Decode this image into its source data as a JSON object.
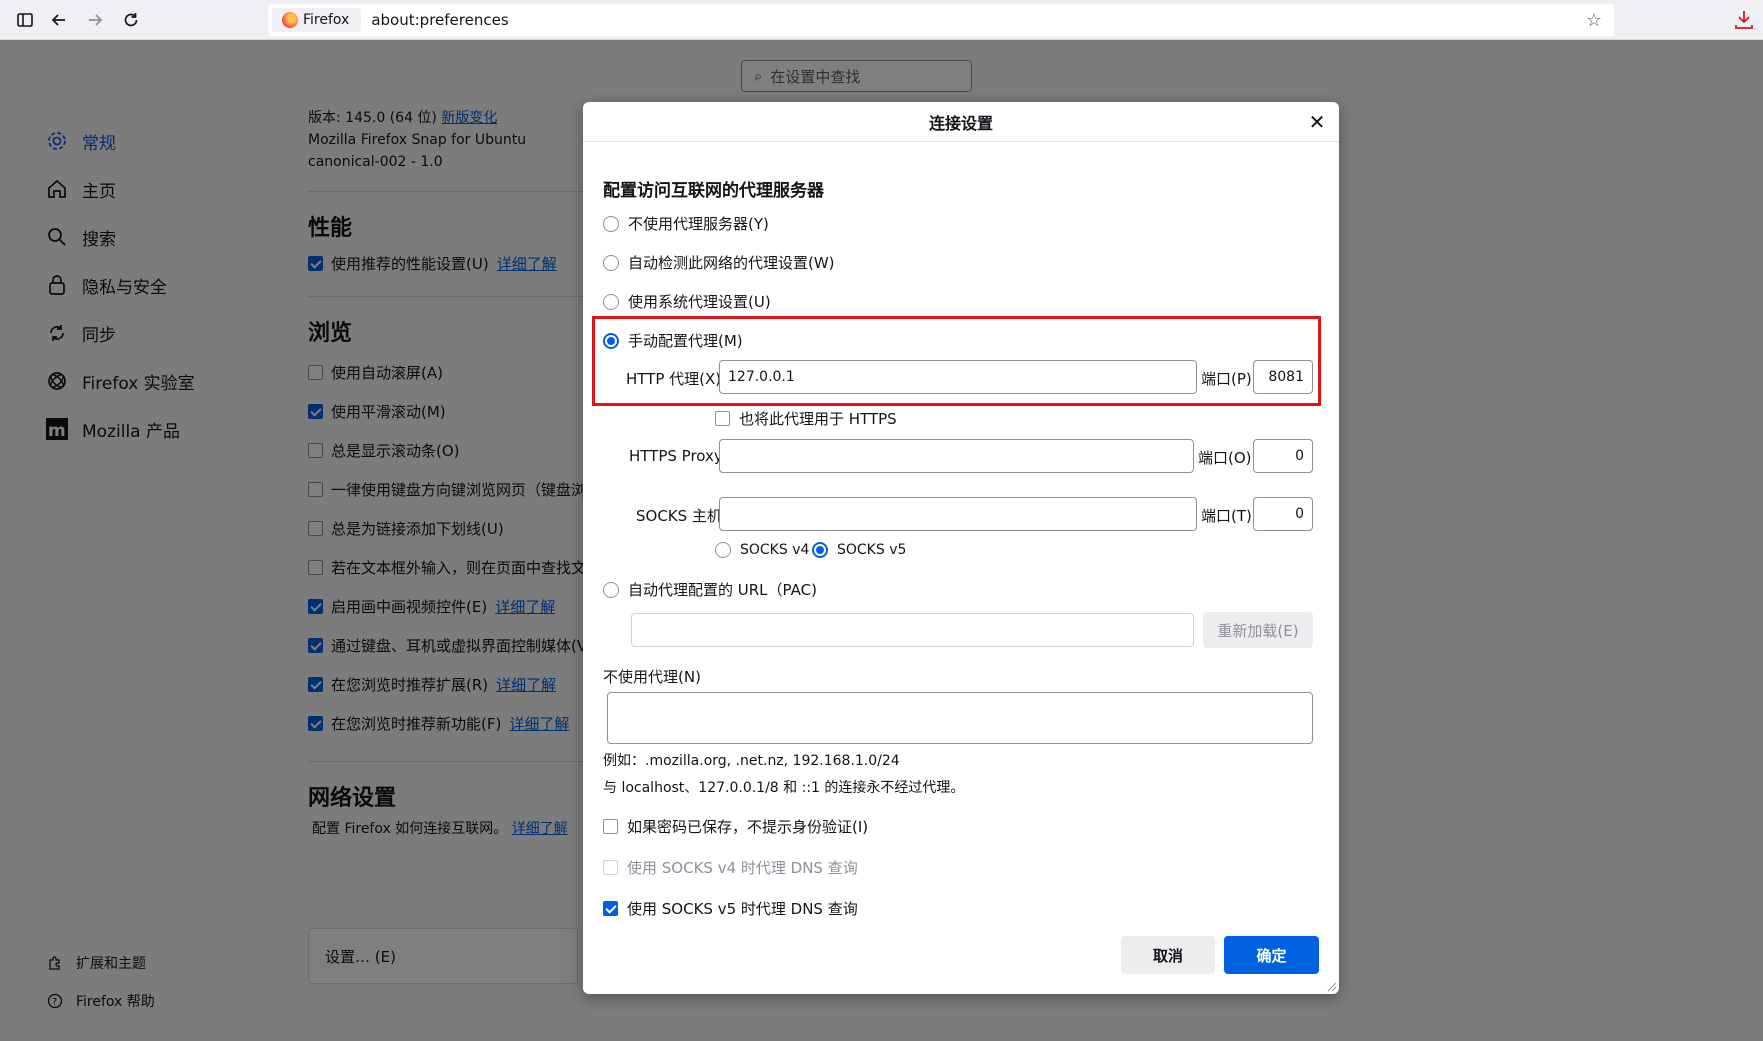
{
  "toolbar": {
    "identity_label": "Firefox",
    "url": "about:preferences"
  },
  "prefs": {
    "search_placeholder": "在设置中查找",
    "nav": [
      {
        "label": "常规"
      },
      {
        "label": "主页"
      },
      {
        "label": "搜索"
      },
      {
        "label": "隐私与安全"
      },
      {
        "label": "同步"
      },
      {
        "label": "Firefox 实验室"
      },
      {
        "label": "Mozilla 产品"
      }
    ],
    "nav_footer": [
      {
        "label": "扩展和主题"
      },
      {
        "label": "Firefox 帮助"
      }
    ],
    "version_line_prefix": "版本: 145.0 (64 位)",
    "version_link": "新版变化",
    "build_line": "Mozilla Firefox Snap for Ubuntu",
    "build_id": "canonical-002 - 1.0",
    "performance_heading": "性能",
    "performance_rows": [
      {
        "label": "使用推荐的性能设置(U)",
        "link": "详细了解",
        "checked": true
      }
    ],
    "browsing_heading": "浏览",
    "browsing_rows": [
      {
        "label": "使用自动滚屏(A)",
        "link": "",
        "checked": false
      },
      {
        "label": "使用平滑滚动(M)",
        "link": "",
        "checked": true
      },
      {
        "label": "总是显示滚动条(O)",
        "link": "",
        "checked": false
      },
      {
        "label": "一律使用键盘方向键浏览网页（键盘浏",
        "link": "",
        "checked": false
      },
      {
        "label": "总是为链接添加下划线(U)",
        "link": "",
        "checked": false
      },
      {
        "label": "若在文本框外输入，则在页面中查找文",
        "link": "",
        "checked": false
      },
      {
        "label": "启用画中画视频控件(E)",
        "link": "详细了解",
        "checked": true
      },
      {
        "label": "通过键盘、耳机或虚拟界面控制媒体(V",
        "link": "",
        "checked": true
      },
      {
        "label": "在您浏览时推荐扩展(R)",
        "link": "详细了解",
        "checked": true
      },
      {
        "label": "在您浏览时推荐新功能(F)",
        "link": "详细了解",
        "checked": true
      }
    ],
    "network_heading": "网络设置",
    "network_desc": "配置 Firefox 如何连接互联网。",
    "network_link": "详细了解",
    "settings_button": "设置… (E)"
  },
  "dialog": {
    "title": "连接设置",
    "heading": "配置访问互联网的代理服务器",
    "proxy_options": [
      {
        "label": "不使用代理服务器(Y)",
        "selected": false
      },
      {
        "label": "自动检测此网络的代理设置(W)",
        "selected": false
      },
      {
        "label": "使用系统代理设置(U)",
        "selected": false
      },
      {
        "label": "手动配置代理(M)",
        "selected": true
      }
    ],
    "http_proxy_label": "HTTP 代理(X)",
    "http_proxy_value": "127.0.0.1",
    "http_port_label": "端口(P)",
    "http_port_value": "8081",
    "also_https_label": "也将此代理用于 HTTPS",
    "also_https_checked": false,
    "https_proxy_label": "HTTPS Proxy",
    "https_proxy_value": "",
    "https_port_label": "端口(O)",
    "https_port_value": "0",
    "socks_host_label": "SOCKS 主机",
    "socks_host_value": "",
    "socks_port_label": "端口(T)",
    "socks_port_value": "0",
    "socks_v4_label": "SOCKS v4",
    "socks_v5_label": "SOCKS v5",
    "socks_version_selected": "v5",
    "pac_label": "自动代理配置的 URL（PAC)",
    "pac_selected": false,
    "pac_value": "",
    "reload_label": "重新加载(E)",
    "no_proxy_label": "不使用代理(N)",
    "no_proxy_value": "",
    "example_text": "例如：.mozilla.org, .net.nz, 192.168.1.0/24",
    "localhost_note": "与 localhost、127.0.0.1/8 和 ::1 的连接永不经过代理。",
    "checkbox_auth_label": "如果密码已保存，不提示身份验证(I)",
    "checkbox_auth_checked": false,
    "checkbox_socks4_dns_label": "使用 SOCKS v4 时代理 DNS 查询",
    "checkbox_socks4_dns_checked": false,
    "checkbox_socks5_dns_label": "使用 SOCKS v5 时代理 DNS 查询",
    "checkbox_socks5_dns_checked": true,
    "cancel_label": "取消",
    "ok_label": "确定",
    "highlight_color": "#e0141c",
    "accent_color": "#0061e0"
  }
}
